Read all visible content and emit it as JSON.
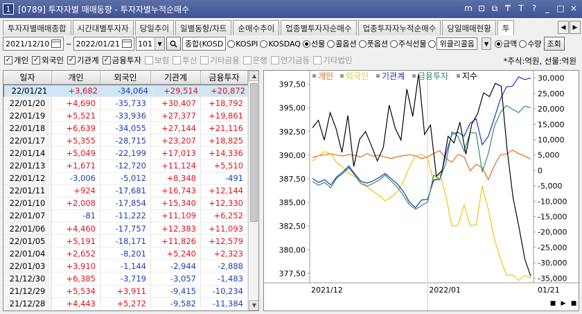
{
  "window": {
    "number": "1",
    "title": "[0789] 투자자별 매매동향 - 투자자별누적순매수"
  },
  "title_buttons": [
    "m",
    "⊡",
    "⧉",
    "₸",
    "T",
    "?",
    "_",
    "□",
    "×"
  ],
  "tabs": [
    "투자자별매매종합",
    "시간대별투자자",
    "당일추이",
    "일별동향/차트",
    "순매수추이",
    "업종별투자자순매수",
    "업종투자자누적순매수",
    "당일매매현황",
    "투"
  ],
  "tab_nav": [
    "◀",
    "▶"
  ],
  "controls": {
    "start_date": "2021/12/10",
    "separator": "~",
    "end_date": "2022/01/21",
    "code": "101",
    "market_select": "종합(KOSD",
    "market_radios": [
      {
        "label": "KOSPI",
        "checked": false
      },
      {
        "label": "KOSDAQ",
        "checked": false
      },
      {
        "label": "선물",
        "checked": true
      },
      {
        "label": "콜옵션",
        "checked": false
      },
      {
        "label": "풋옵션",
        "checked": false
      },
      {
        "label": "주식선물",
        "checked": false
      },
      {
        "label": "위클리콜옵",
        "checked": false
      }
    ],
    "value_radios": [
      {
        "label": "금액",
        "checked": true
      },
      {
        "label": "수량",
        "checked": false
      }
    ],
    "query_button": "조회"
  },
  "filters": [
    {
      "label": "개인",
      "checked": true,
      "enabled": true
    },
    {
      "label": "외국인",
      "checked": true,
      "enabled": true
    },
    {
      "label": "기관계",
      "checked": true,
      "enabled": true
    },
    {
      "label": "금융투자",
      "checked": true,
      "enabled": true
    },
    {
      "label": "보험",
      "checked": false,
      "enabled": false
    },
    {
      "label": "투신",
      "checked": false,
      "enabled": false
    },
    {
      "label": "기타금융",
      "checked": false,
      "enabled": false
    },
    {
      "label": "은행",
      "checked": false,
      "enabled": false
    },
    {
      "label": "연기금등",
      "checked": false,
      "enabled": false
    },
    {
      "label": "기타법인",
      "checked": false,
      "enabled": false
    }
  ],
  "unit_note": "*주식:억원, 선물:억원",
  "table": {
    "headers": [
      "일자",
      "개인",
      "외국인",
      "기관계",
      "금융투자"
    ],
    "rows": [
      [
        "22/01/21",
        "+3,682",
        "-34,064",
        "+29,514",
        "+20,872"
      ],
      [
        "22/01/20",
        "+4,690",
        "-35,733",
        "+30,407",
        "+18,792"
      ],
      [
        "22/01/19",
        "+5,521",
        "-33,936",
        "+27,377",
        "+19,861"
      ],
      [
        "22/01/18",
        "+6,639",
        "-34,055",
        "+27,144",
        "+21,116"
      ],
      [
        "22/01/17",
        "+5,355",
        "-28,715",
        "+23,207",
        "+18,825"
      ],
      [
        "22/01/14",
        "+5,049",
        "-22,199",
        "+17,013",
        "+14,336"
      ],
      [
        "22/01/13",
        "+1,671",
        "-12,720",
        "+11,124",
        "+5,510"
      ],
      [
        "22/01/12",
        "-3,006",
        "-5,012",
        "+8,348",
        "-491"
      ],
      [
        "22/01/11",
        "+924",
        "-17,681",
        "+16,743",
        "+12,144"
      ],
      [
        "22/01/10",
        "+2,008",
        "-17,854",
        "+15,340",
        "+12,330"
      ],
      [
        "22/01/07",
        "-81",
        "-11,222",
        "+11,109",
        "+6,252"
      ],
      [
        "22/01/06",
        "+4,460",
        "-17,757",
        "+12,383",
        "+11,093"
      ],
      [
        "22/01/05",
        "+5,191",
        "-18,171",
        "+11,826",
        "+12,579"
      ],
      [
        "22/01/04",
        "+2,652",
        "-8,201",
        "+5,240",
        "+2,323"
      ],
      [
        "22/01/03",
        "+3,910",
        "-1,144",
        "-2,944",
        "-2,888"
      ],
      [
        "21/12/30",
        "+6,385",
        "-3,719",
        "-3,057",
        "-1,483"
      ],
      [
        "21/12/29",
        "+5,534",
        "+3,911",
        "-9,415",
        "-10,234"
      ],
      [
        "21/12/28",
        "+4,443",
        "+5,272",
        "-9,582",
        "-11,384"
      ]
    ]
  },
  "scroll_arrows": [
    "▲",
    "▼"
  ],
  "chart_data": {
    "type": "line",
    "legend": [
      "개인",
      "외국인",
      "기관계",
      "금융투자",
      "지수"
    ],
    "colors": {
      "개인": "#e8661a",
      "외국인": "#f1c40f",
      "기관계": "#1d2fbf",
      "금융투자": "#2e8b70",
      "지수": "#000000"
    },
    "x_labels": [
      "2021/12",
      "2022/01",
      "01/21"
    ],
    "left_axis": {
      "ticks": [
        "397,50",
        "395,00",
        "392,50",
        "390,00",
        "387,50",
        "385,00",
        "382,50",
        "380,00",
        "377,50"
      ],
      "ylim": [
        376.5,
        398.5
      ]
    },
    "right_axis": {
      "ticks": [
        "30,000",
        "25,000",
        "20,000",
        "15,000",
        "10,000",
        "5,000",
        "0",
        "-5,000",
        "-10,000",
        "-15,000",
        "-20,000",
        "-25,000",
        "-30,000",
        "-35,000"
      ],
      "ylim": [
        -36500,
        31500
      ]
    },
    "series": [
      {
        "name": "개인",
        "axis": "right",
        "values": [
          4200,
          4800,
          5100,
          5400,
          5000,
          4700,
          5200,
          4900,
          4400,
          5500,
          4600,
          5000,
          4300,
          3900,
          4500,
          4800,
          5100,
          4700,
          3900,
          4443,
          5534,
          6385,
          3910,
          2652,
          5191,
          4460,
          -81,
          2008,
          924,
          -3006,
          1671,
          5049,
          5355,
          6639,
          5521,
          4690,
          3682
        ]
      },
      {
        "name": "외국인",
        "axis": "right",
        "values": [
          3000,
          4800,
          6100,
          5400,
          2600,
          1000,
          -900,
          -2100,
          -3400,
          -5200,
          -6800,
          -8100,
          -9900,
          -8600,
          -6900,
          -3400,
          1200,
          4700,
          5272,
          3911,
          -3719,
          -1144,
          -8201,
          -18171,
          -17757,
          -11222,
          -17854,
          -17681,
          -5012,
          -12720,
          -22199,
          -28715,
          -34055,
          -33936,
          -35733,
          -34064,
          -35000
        ]
      },
      {
        "name": "기관계",
        "axis": "right",
        "values": [
          -2600,
          -3900,
          -3000,
          -4700,
          -2100,
          -500,
          1400,
          -1200,
          -3600,
          -4100,
          -3400,
          -2300,
          -1000,
          -2700,
          -4400,
          -6900,
          -10300,
          -12100,
          -9582,
          -9415,
          -3057,
          -2944,
          5240,
          11826,
          12383,
          11109,
          15340,
          16743,
          8348,
          11124,
          17013,
          23207,
          27144,
          27377,
          30407,
          29514,
          30000
        ]
      },
      {
        "name": "금융투자",
        "axis": "right",
        "values": [
          -3600,
          -4800,
          -3900,
          -5600,
          -2500,
          -1000,
          900,
          -1700,
          -4300,
          -5100,
          -4200,
          -3100,
          -1500,
          -3500,
          -5400,
          -8200,
          -11200,
          -12600,
          -11384,
          -10234,
          -1483,
          -2888,
          2323,
          12579,
          11093,
          6252,
          12330,
          12144,
          -491,
          5510,
          14336,
          18825,
          21116,
          19861,
          18792,
          20872,
          20400
        ]
      },
      {
        "name": "지수",
        "axis": "left",
        "values": [
          392.9,
          393.7,
          391.6,
          394.5,
          392.8,
          390.3,
          394.2,
          388.8,
          391.7,
          392.5,
          391.0,
          389.4,
          390.8,
          395.3,
          392.9,
          391.6,
          397.0,
          394.1,
          398.6,
          392.2,
          393.2,
          387.8,
          388.4,
          392.0,
          391.3,
          393.5,
          390.1,
          393.3,
          394.4,
          396.6,
          396.2,
          397.6,
          397.3,
          390.6,
          385.5,
          382.4,
          379.0,
          377.2
        ]
      }
    ]
  },
  "chart_controls": [
    "■",
    "▶",
    "■"
  ]
}
